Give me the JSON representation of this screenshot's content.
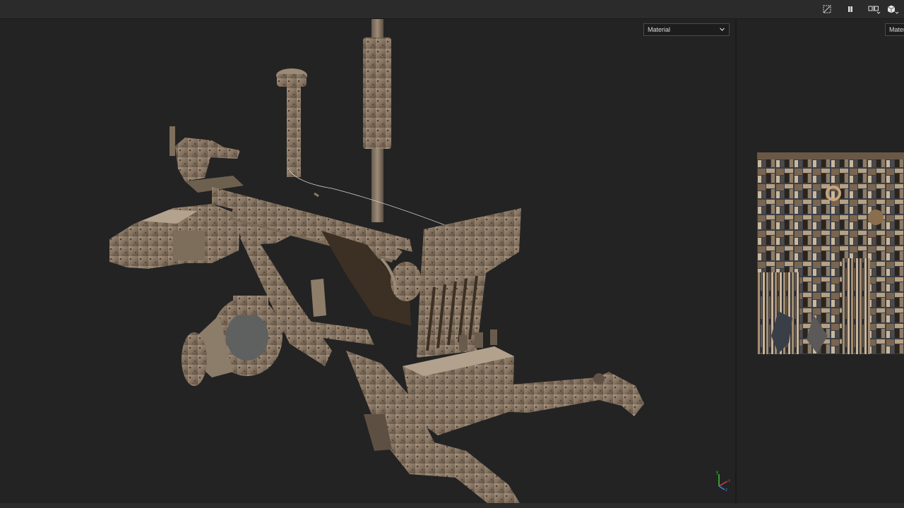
{
  "toolbar": {
    "icons": [
      "hide-grid-icon",
      "pause-icon",
      "split-view-icon",
      "cube-view-icon"
    ]
  },
  "viewport3d": {
    "channel_select": {
      "value": "Material"
    }
  },
  "viewport2d": {
    "channel_select": {
      "value": "Mater"
    }
  },
  "colors": {
    "background": "#222222",
    "toolbar": "#2b2b2b",
    "rust_metal": "#8a7a66",
    "gizmo_x": "#d04040",
    "gizmo_y": "#40c040",
    "gizmo_z": "#4080e0"
  }
}
